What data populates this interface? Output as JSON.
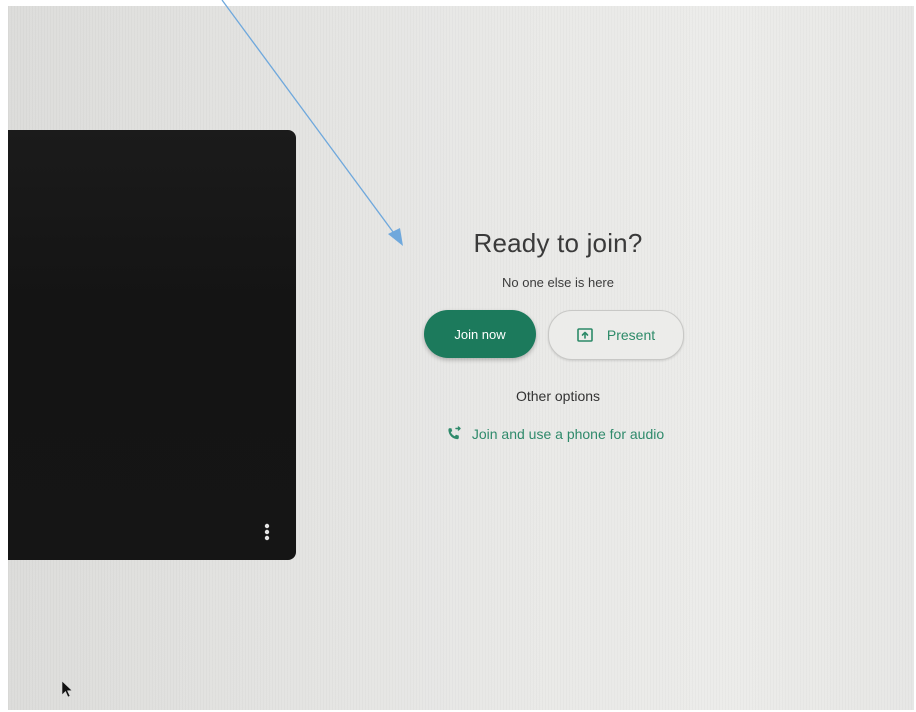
{
  "prejoin": {
    "title": "Ready to join?",
    "status": "No one else is here",
    "join_button_label": "Join now",
    "present_button_label": "Present",
    "other_options_label": "Other options",
    "phone_audio_label": "Join and use a phone for audio"
  },
  "icons": {
    "more_options": "more-vert-icon",
    "present": "present-screen-icon",
    "phone": "phone-forwarded-icon",
    "cursor": "mouse-pointer-icon"
  },
  "colors": {
    "accent": "#1c7a5c",
    "link": "#2f8a6b",
    "annotation_arrow": "#6fa8dc"
  }
}
